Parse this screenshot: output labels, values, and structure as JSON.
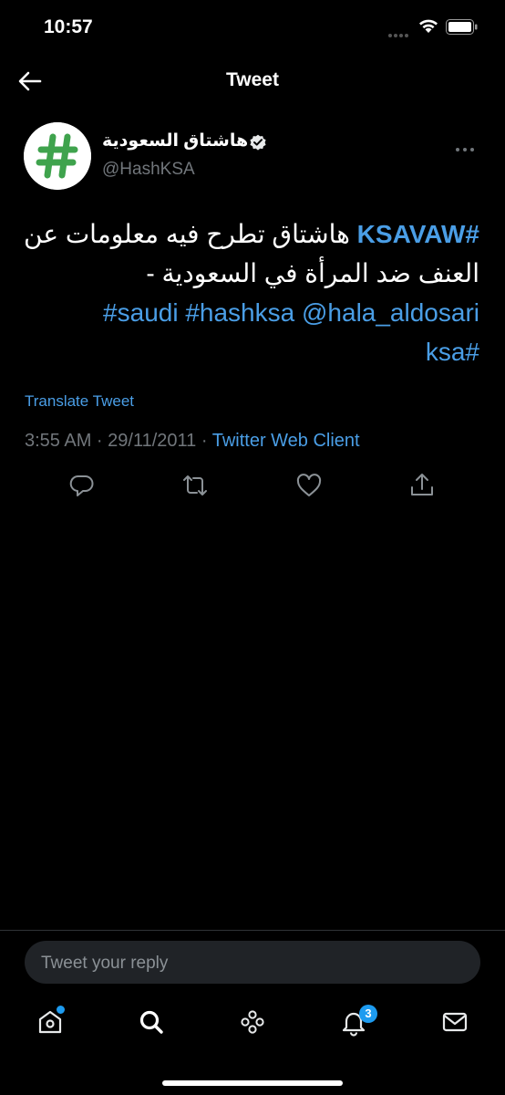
{
  "status_bar": {
    "time": "10:57"
  },
  "nav": {
    "title": "Tweet"
  },
  "tweet": {
    "display_name": "هاشتاق السعودية",
    "handle": "@HashKSA",
    "text": {
      "tag_main": "#KSAVAW",
      "arabic_line": "هاشتاق تطرح فيه معلومات عن العنف ضد المرأة في السعودية  -",
      "tag_saudi": "#saudi",
      "tag_hashksa": "#hashksa",
      "mention": "@hala_aldosari",
      "tag_ksa": "#ksa"
    },
    "translate_label": "Translate Tweet",
    "timestamp": "3:55 AM · 29/11/2011 · ",
    "client": "Twitter Web Client"
  },
  "reply": {
    "placeholder": "Tweet your reply"
  },
  "tabs": {
    "notifications_count": "3"
  },
  "colors": {
    "accent": "#1d9bf0",
    "link": "#4a9ee6",
    "background": "#000000",
    "avatar_green": "#3fa34d"
  }
}
